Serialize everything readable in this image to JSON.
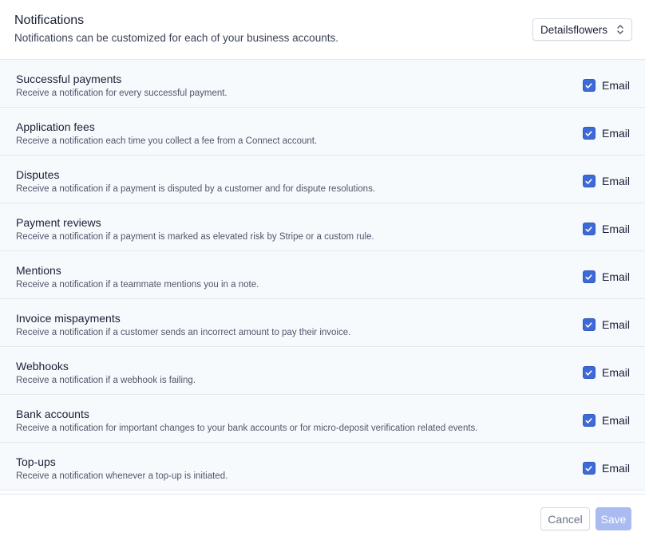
{
  "header": {
    "title": "Notifications",
    "subtitle": "Notifications can be customized for each of your business accounts.",
    "account_select": {
      "value": "Detailsflowers"
    }
  },
  "notifications": [
    {
      "name": "Successful payments",
      "description": "Receive a notification for every successful payment.",
      "channel": "Email",
      "checked": true
    },
    {
      "name": "Application fees",
      "description": "Receive a notification each time you collect a fee from a Connect account.",
      "channel": "Email",
      "checked": true
    },
    {
      "name": "Disputes",
      "description": "Receive a notification if a payment is disputed by a customer and for dispute resolutions.",
      "channel": "Email",
      "checked": true
    },
    {
      "name": "Payment reviews",
      "description": "Receive a notification if a payment is marked as elevated risk by Stripe or a custom rule.",
      "channel": "Email",
      "checked": true
    },
    {
      "name": "Mentions",
      "description": "Receive a notification if a teammate mentions you in a note.",
      "channel": "Email",
      "checked": true
    },
    {
      "name": "Invoice mispayments",
      "description": "Receive a notification if a customer sends an incorrect amount to pay their invoice.",
      "channel": "Email",
      "checked": true
    },
    {
      "name": "Webhooks",
      "description": "Receive a notification if a webhook is failing.",
      "channel": "Email",
      "checked": true
    },
    {
      "name": "Bank accounts",
      "description": "Receive a notification for important changes to your bank accounts or for micro-deposit verification related events.",
      "channel": "Email",
      "checked": true
    },
    {
      "name": "Top-ups",
      "description": "Receive a notification whenever a top-up is initiated.",
      "channel": "Email",
      "checked": true
    }
  ],
  "footer": {
    "cancel_label": "Cancel",
    "save_label": "Save"
  },
  "colors": {
    "checkbox": "#3d6ad6",
    "save_disabled": "#a9bbf0",
    "list_background": "#f7fafc"
  },
  "icons": {
    "account_select": "chevron-up-down-icon",
    "checkbox": "checkmark-icon"
  }
}
